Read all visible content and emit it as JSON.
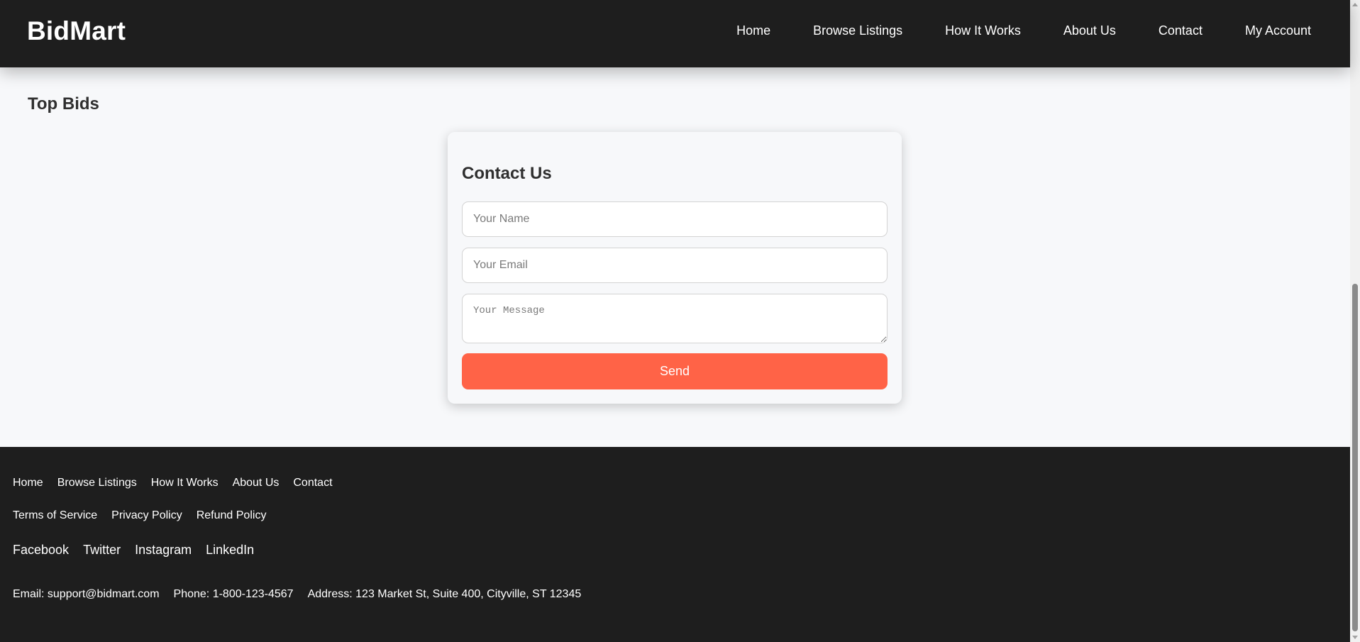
{
  "header": {
    "brand": "BidMart",
    "nav": [
      "Home",
      "Browse Listings",
      "How It Works",
      "About Us",
      "Contact",
      "My Account"
    ]
  },
  "main": {
    "section_title": "Top Bids",
    "contact_form": {
      "title": "Contact Us",
      "name_placeholder": "Your Name",
      "email_placeholder": "Your Email",
      "message_placeholder": "Your Message",
      "submit_label": "Send"
    }
  },
  "footer": {
    "links": [
      "Home",
      "Browse Listings",
      "How It Works",
      "About Us",
      "Contact"
    ],
    "policies": [
      "Terms of Service",
      "Privacy Policy",
      "Refund Policy"
    ],
    "social": [
      "Facebook",
      "Twitter",
      "Instagram",
      "LinkedIn"
    ],
    "contact": {
      "email": "Email: support@bidmart.com",
      "phone": "Phone: 1-800-123-4567",
      "address": "Address: 123 Market St, Suite 400, Cityville, ST 12345"
    }
  },
  "colors": {
    "header_bg": "#1e1e1e",
    "page_bg": "#f7f8fa",
    "accent": "#ff6347",
    "footer_bg": "#1e1e1e"
  }
}
